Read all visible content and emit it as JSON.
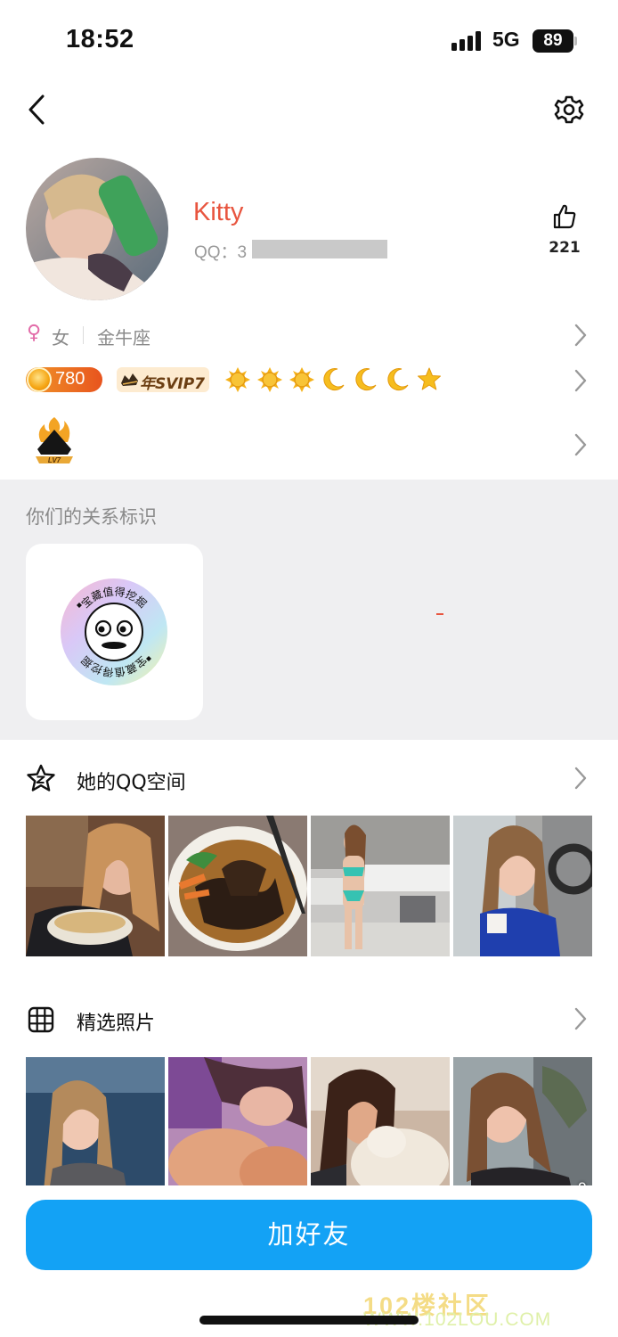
{
  "status_bar": {
    "time": "18:52",
    "network": "5G",
    "battery": "89"
  },
  "profile": {
    "nickname": "Kitty",
    "qq_label": "QQ：3",
    "likes": "221",
    "gender_symbol": "♀",
    "gender": "女",
    "zodiac": "金牛座",
    "coin_value": "780",
    "svip_label": "年SVIP7",
    "level_icons": [
      "sun-icon",
      "sun-icon",
      "sun-icon",
      "moon-icon",
      "moon-icon",
      "moon-icon",
      "star-icon"
    ],
    "lv_badge": "LV7"
  },
  "relationship": {
    "title": "你们的关系标识",
    "medal_text": "宝藏值得挖掘"
  },
  "qzone": {
    "title": "她的QQ空间"
  },
  "photos": {
    "title": "精选照片",
    "count": "9"
  },
  "actions": {
    "add_friend": "加好友"
  },
  "watermark": {
    "line1": "102楼社区",
    "line2": "WWW.102LOU.COM"
  },
  "colors": {
    "accent": "#13a2f5",
    "nickname": "#e8553f",
    "section_bg": "#efeff1"
  }
}
